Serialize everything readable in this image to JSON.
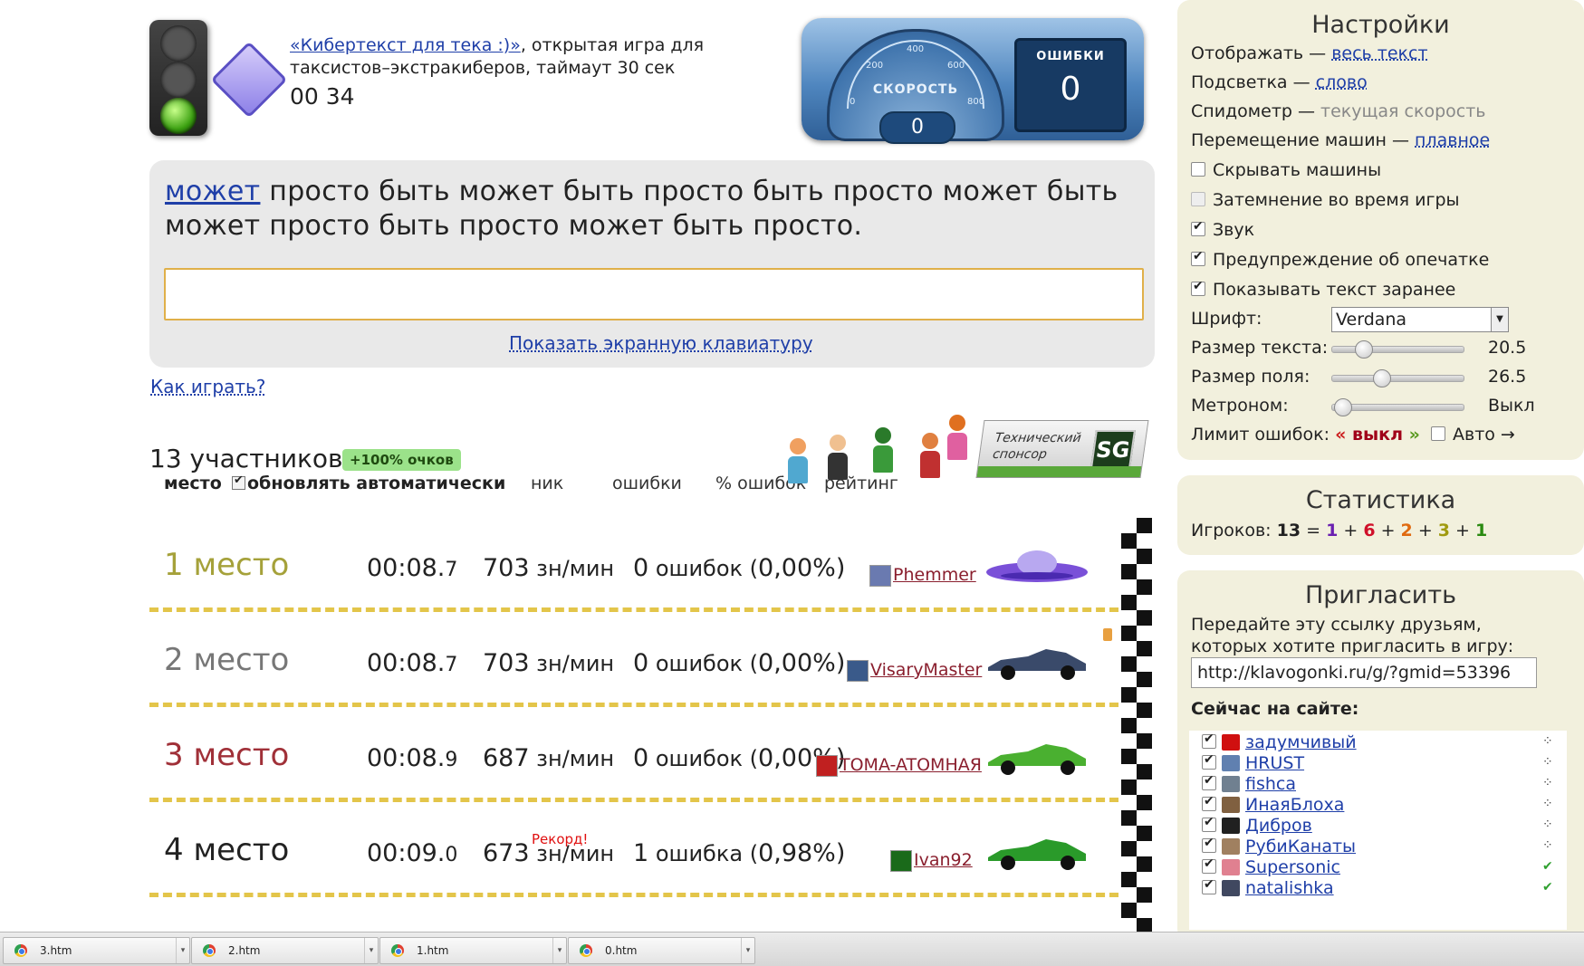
{
  "header": {
    "game_link": "«Кибертекст для тека :)»",
    "game_desc": ", открытая игра для таксистов–экстракиберов, таймаут 30 сек",
    "timer": "00 34"
  },
  "speedometer": {
    "label": "СКОРОСТЬ",
    "value": "0",
    "ticks": [
      "0",
      "200",
      "400",
      "600",
      "800"
    ]
  },
  "errors_box": {
    "label": "ОШИБКИ",
    "value": "0"
  },
  "text_panel": {
    "current_word": "может",
    "rest_text": " просто быть может быть просто быть просто может быть может просто быть просто может быть просто.",
    "input_value": "",
    "keyboard_link": "Показать экранную клавиатуру"
  },
  "how_to_play": "Как играть?",
  "participants": {
    "count_label": "13 участников",
    "bonus": "+100% очков"
  },
  "columns": {
    "place": "место",
    "auto_update": "обновлять автоматически",
    "nick": "ник",
    "errors": "ошибки",
    "err_percent": "% ошибок",
    "rating": "рейтинг"
  },
  "sponsor": {
    "line1": "Технический",
    "line2": "спонсор",
    "logo": "SG"
  },
  "results": [
    {
      "place": "1 место",
      "place_color": "#a5a13a",
      "time": "00:08.",
      "time_ms": "7",
      "speed": "703",
      "speed_unit": " зн/мин",
      "errors": "0",
      "errors_text": " ошибок (",
      "percent": "0,00%",
      "close": ")",
      "nick": "Phemmer",
      "car": "ufo"
    },
    {
      "place": "2 место",
      "place_color": "#777777",
      "time": "00:08.",
      "time_ms": "7",
      "speed": "703",
      "speed_unit": " зн/мин",
      "errors": "0",
      "errors_text": " ошибок (",
      "percent": "0,00%",
      "close": ")",
      "nick": "VisaryMaster",
      "car": "f1-dark"
    },
    {
      "place": "3 место",
      "place_color": "#a03038",
      "time": "00:08.",
      "time_ms": "9",
      "speed": "687",
      "speed_unit": " зн/мин",
      "errors": "0",
      "errors_text": " ошибок (",
      "percent": "0,00%",
      "close": ")",
      "nick": "TOMA-ATOMHAЯ",
      "car": "f1-green"
    },
    {
      "place": "4 место",
      "place_color": "#222222",
      "time": "00:09.",
      "time_ms": "0",
      "speed": "673",
      "speed_unit": " зн/мин",
      "errors": "1",
      "errors_text": " ошибка (",
      "percent": "0,98%",
      "close": ")",
      "nick": "Ivan92",
      "car": "sport-green"
    }
  ],
  "record_label": "Рекорд!",
  "settings": {
    "title": "Настройки",
    "display_label": "Отображать — ",
    "display_value": "весь текст",
    "highlight_label": "Подсветка — ",
    "highlight_value": "слово",
    "speedo_label": "Спидометр — ",
    "speedo_value": "текущая скорость",
    "cars_move_label": "Перемещение машин — ",
    "cars_move_value": "плавное",
    "hide_cars": "Скрывать машины",
    "dim_during_game": "Затемнение во время игры",
    "sound": "Звук",
    "typo_warning": "Предупреждение об опечатке",
    "show_text_ahead": "Показывать текст заранее",
    "font_label": "Шрифт:",
    "font_value": "Verdana",
    "text_size_label": "Размер текста:",
    "text_size_value": "20.5",
    "field_size_label": "Размер поля:",
    "field_size_value": "26.5",
    "metronome_label": "Метроном:",
    "metronome_value": "Выкл",
    "error_limit_label": "Лимит ошибок:",
    "error_limit_value": "выкл",
    "auto_label": "Авто →"
  },
  "statistics": {
    "title": "Статистика",
    "players_label": "Игроков: ",
    "total": "13",
    "n1": "1",
    "n2": "6",
    "n3": "2",
    "n4": "3",
    "n5": "1",
    "colors": [
      "#6a1fb0",
      "#d0102a",
      "#e06a10",
      "#a09a10",
      "#2a8a10"
    ]
  },
  "invite": {
    "title": "Пригласить",
    "desc": "Передайте эту ссылку друзьям, которых хотите пригласить в игру:",
    "url": "http://klavogonki.ru/g/?gmid=53396",
    "online_title": "Сейчас на сайте:"
  },
  "online_users": [
    {
      "name": "задумчивый",
      "status": "loading"
    },
    {
      "name": "HRUST",
      "status": "loading"
    },
    {
      "name": "fishca",
      "status": "loading"
    },
    {
      "name": "ИнаяБлоха",
      "status": "loading"
    },
    {
      "name": "Дибров",
      "status": "loading"
    },
    {
      "name": "РубиКанаты",
      "status": "loading"
    },
    {
      "name": "Supersonic",
      "status": "done"
    },
    {
      "name": "natalishka",
      "status": "done"
    }
  ],
  "taskbar_tabs": [
    "3.htm",
    "2.htm",
    "1.htm",
    "0.htm"
  ]
}
